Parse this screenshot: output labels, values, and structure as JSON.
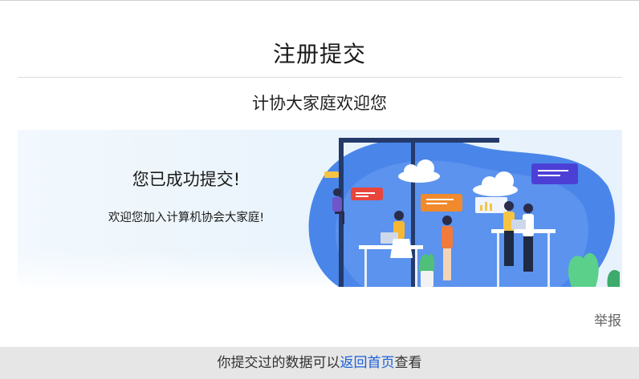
{
  "page": {
    "title": "注册提交",
    "subtitle": "计协大家庭欢迎您"
  },
  "banner": {
    "headline": "您已成功提交!",
    "message": "欢迎您加入计算机协会大家庭!"
  },
  "report_label": "举报",
  "footer": {
    "prefix": "你提交过的数据可以",
    "link_label": "返回首页",
    "suffix": "查看"
  },
  "colors": {
    "accent_link": "#1a5fd8",
    "footer_bg": "#e6e6e6",
    "banner_blue": "#3d7de8"
  }
}
